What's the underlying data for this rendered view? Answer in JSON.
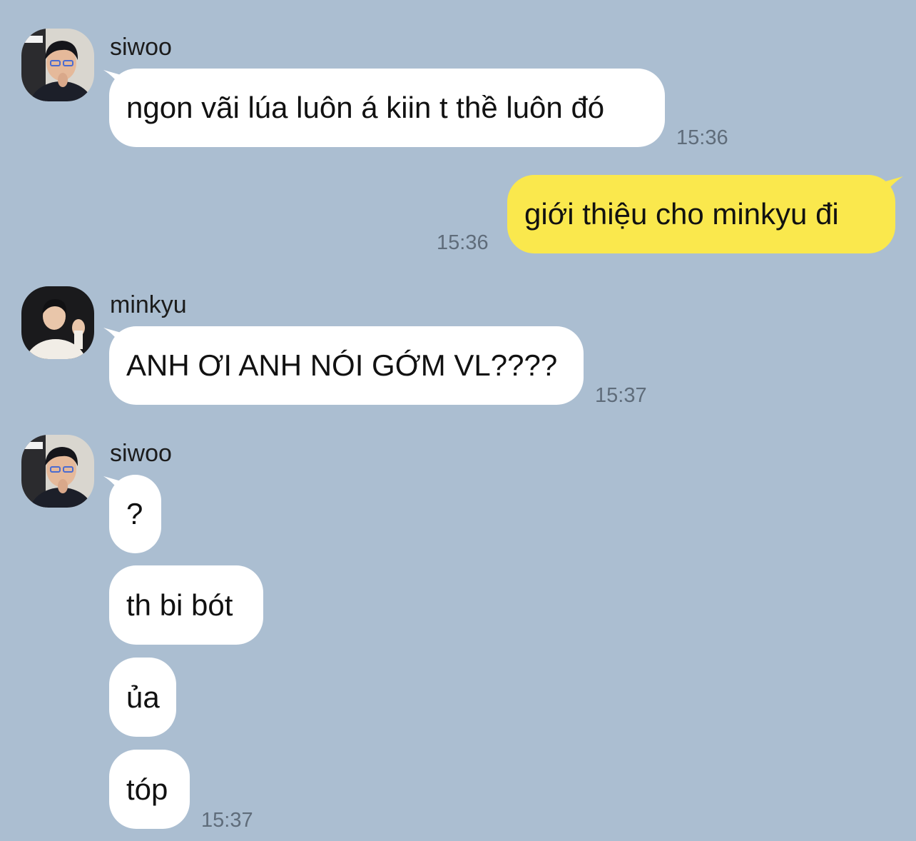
{
  "colors": {
    "background": "#abbed1",
    "bubble_incoming": "#ffffff",
    "bubble_outgoing": "#fae84d",
    "timestamp": "#5f6c7a"
  },
  "messages": [
    {
      "sender": "siwoo",
      "avatar_icon": "siwoo-avatar",
      "text": "ngon vãi lúa luôn á kiin t thề luôn đó",
      "time": "15:36"
    },
    {
      "sender": "me",
      "text": "giới thiệu cho minkyu đi",
      "time": "15:36"
    },
    {
      "sender": "minkyu",
      "avatar_icon": "minkyu-avatar",
      "text": "ANH ƠI ANH NÓI GỚM VL????",
      "time": "15:37"
    },
    {
      "sender": "siwoo",
      "avatar_icon": "siwoo-avatar",
      "lines": [
        "?",
        "th bi bót",
        "ủa",
        "tóp"
      ],
      "time": "15:37"
    }
  ]
}
